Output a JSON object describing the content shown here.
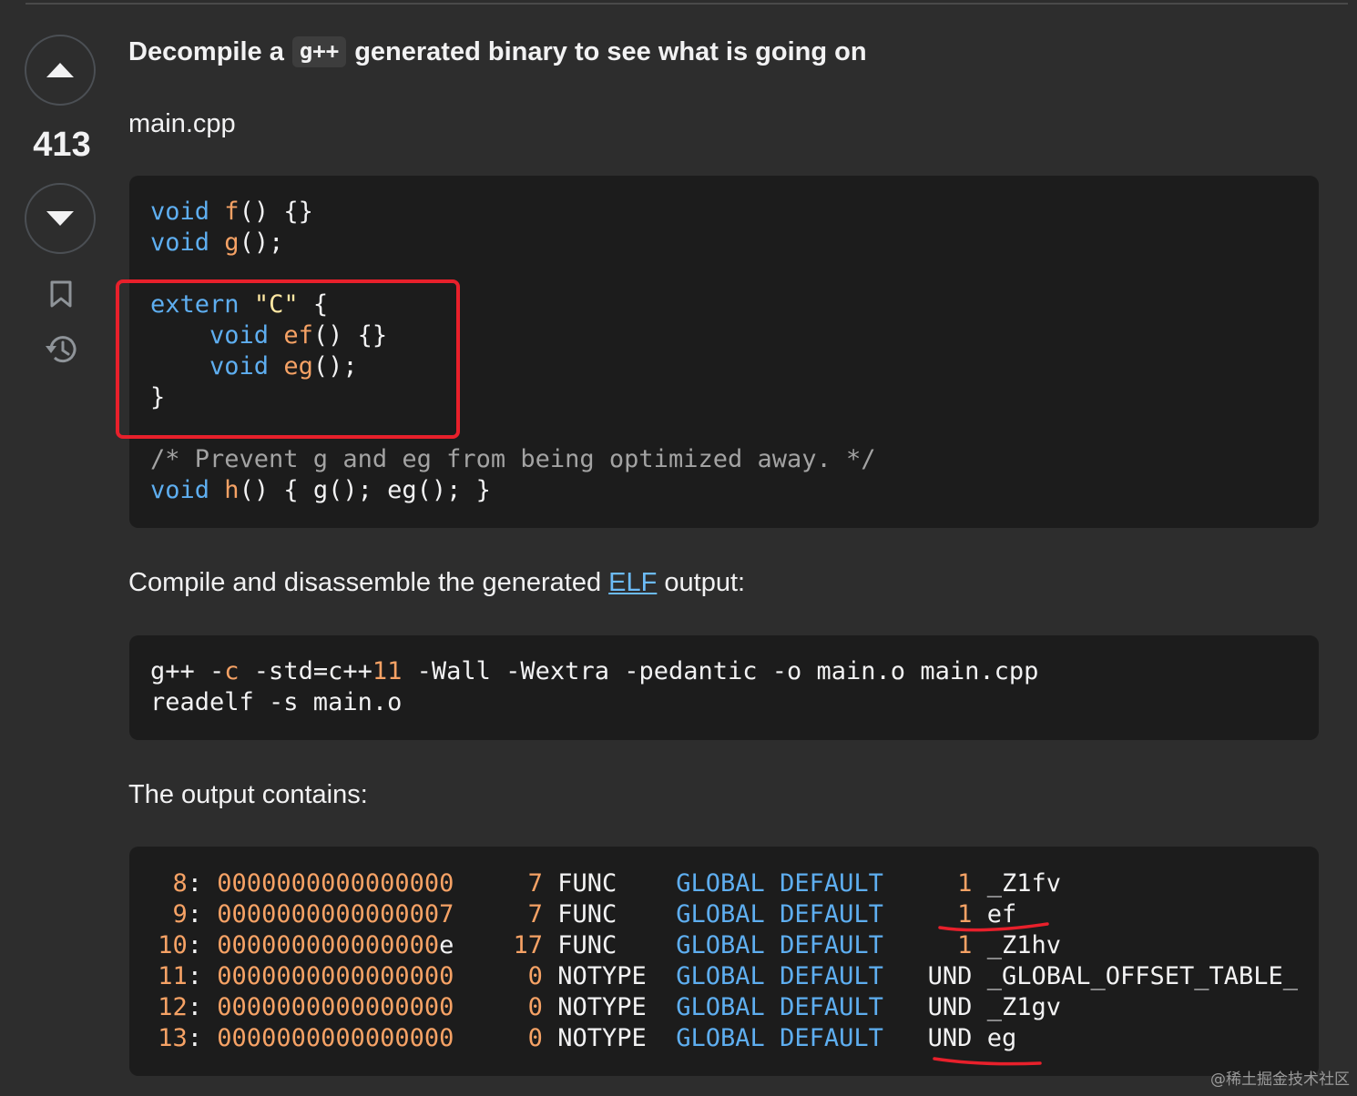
{
  "post": {
    "heading_before": "Decompile a",
    "heading_code": "g++",
    "heading_after": "generated binary to see what is going on",
    "vote_count": "413",
    "file_label": "main.cpp",
    "compile_text_before": "Compile and disassemble the generated ",
    "compile_link": "ELF",
    "compile_text_after": " output:",
    "output_text": "The output contains:"
  },
  "code_main": {
    "line1_kw": "void",
    "line1_fn": "f",
    "line1_rest": "() {}",
    "line2_kw": "void",
    "line2_fn": "g",
    "line2_rest": "();",
    "line3_kw": "extern",
    "line3_str": "\"C\"",
    "line3_rest": " {",
    "line4_kw": "void",
    "line4_fn": "ef",
    "line4_rest": "() {}",
    "line5_kw": "void",
    "line5_fn": "eg",
    "line5_rest": "();",
    "line6": "}",
    "comment": "/* Prevent g and eg from being optimized away. */",
    "line8_kw": "void",
    "line8_fn": "h",
    "line8_rest": "() { g(); eg(); }"
  },
  "code_compile": {
    "l1_a": "g++ -",
    "l1_b": "c",
    "l1_c": " -std=c++",
    "l1_d": "11",
    "l1_e": " -Wall -Wextra -pedantic -o main.o main.cpp",
    "l2": "readelf -s main.o"
  },
  "symbol_table": {
    "rows": [
      {
        "num": "8",
        "value": "0000000000000000",
        "size": "7",
        "type": "FUNC",
        "bind": "GLOBAL",
        "vis": "DEFAULT",
        "ndx": "1",
        "name": "_Z1fv"
      },
      {
        "num": "9",
        "value": "0000000000000007",
        "size": "7",
        "type": "FUNC",
        "bind": "GLOBAL",
        "vis": "DEFAULT",
        "ndx": "1",
        "name": "ef"
      },
      {
        "num": "10",
        "value": "000000000000000",
        "value_tail": "e",
        "size": "17",
        "type": "FUNC",
        "bind": "GLOBAL",
        "vis": "DEFAULT",
        "ndx": "1",
        "name": "_Z1hv"
      },
      {
        "num": "11",
        "value": "0000000000000000",
        "size": "0",
        "type": "NOTYPE",
        "bind": "GLOBAL",
        "vis": "DEFAULT",
        "ndx": "UND",
        "name": "_GLOBAL_OFFSET_TABLE_"
      },
      {
        "num": "12",
        "value": "0000000000000000",
        "size": "0",
        "type": "NOTYPE",
        "bind": "GLOBAL",
        "vis": "DEFAULT",
        "ndx": "UND",
        "name": "_Z1gv"
      },
      {
        "num": "13",
        "value": "0000000000000000",
        "size": "0",
        "type": "NOTYPE",
        "bind": "GLOBAL",
        "vis": "DEFAULT",
        "ndx": "UND",
        "name": "eg"
      }
    ]
  },
  "watermark": "@稀土掘金技术社区",
  "icons": {
    "upvote": "caret-up-icon",
    "downvote": "caret-down-icon",
    "bookmark": "bookmark-icon",
    "history": "history-icon"
  },
  "colors": {
    "background": "#2d2d2d",
    "code_background": "#1c1c1c",
    "keyword": "#5eaef0",
    "function": "#f6a265",
    "string": "#ffe8a3",
    "comment": "#a3a3a3",
    "link": "#6cbbf7",
    "annotation": "#e8202b"
  }
}
